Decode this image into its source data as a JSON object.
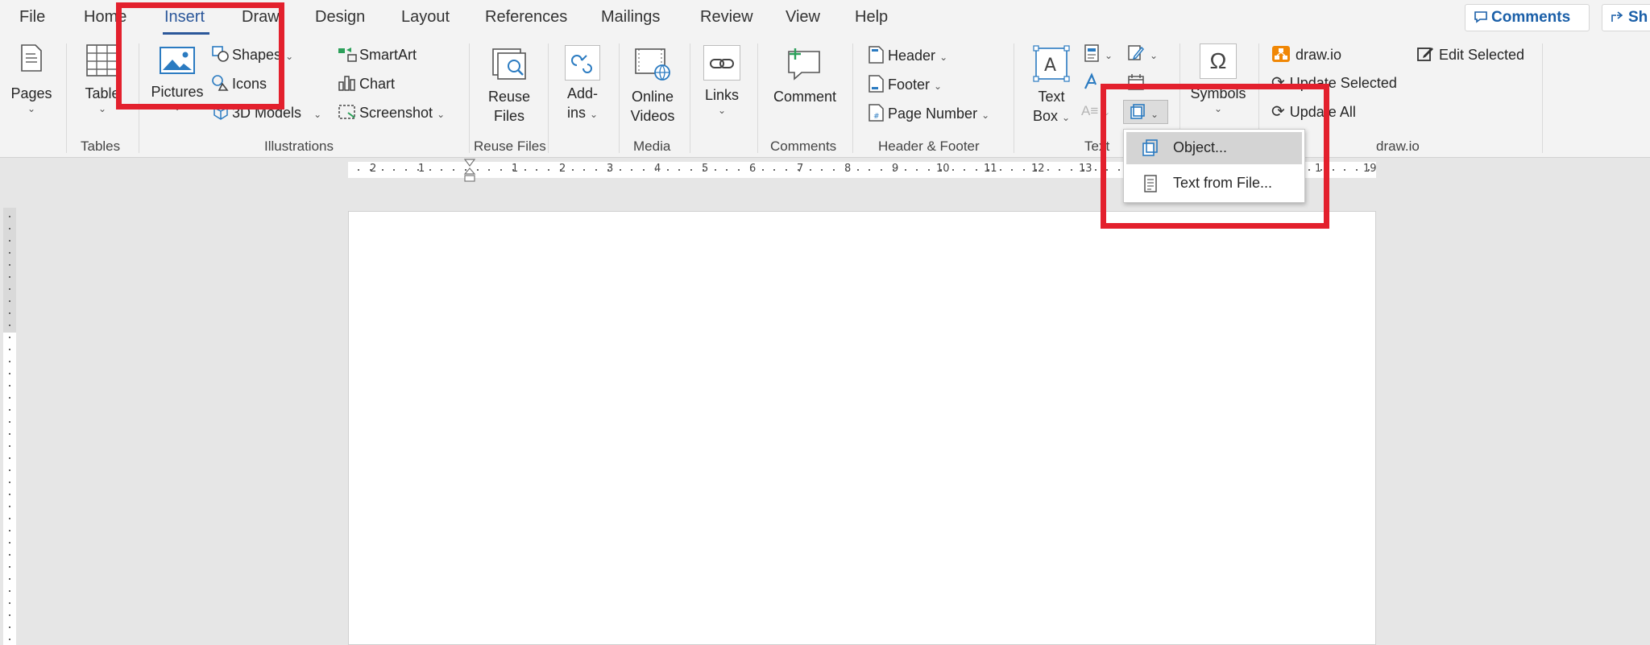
{
  "tabs": [
    "File",
    "Home",
    "Insert",
    "Draw",
    "Design",
    "Layout",
    "References",
    "Mailings",
    "Review",
    "View",
    "Help"
  ],
  "active_tab": "Insert",
  "top_right": {
    "comments": "Comments",
    "share": "Sh"
  },
  "ribbon": {
    "pages": "Pages",
    "table": "Table",
    "pictures": "Pictures",
    "shapes": "Shapes",
    "icons": "Icons",
    "models_3d": "3D Models",
    "smartart": "SmartArt",
    "chart": "Chart",
    "screenshot": "Screenshot",
    "reuse_files": [
      "Reuse",
      "Files"
    ],
    "addins": [
      "Add-",
      "ins"
    ],
    "online_videos": [
      "Online",
      "Videos"
    ],
    "links": "Links",
    "comment": "Comment",
    "header": "Header",
    "footer": "Footer",
    "page_number": "Page Number",
    "text_box": [
      "Text",
      "Box"
    ],
    "symbols": "Symbols",
    "drawio": "draw.io",
    "update_selected": "Update Selected",
    "update_all": "Update All",
    "edit_selected": "Edit Selected",
    "groups": {
      "tables": "Tables",
      "illustrations": "Illustrations",
      "reuse_files": "Reuse Files",
      "media": "Media",
      "comments": "Comments",
      "header_footer": "Header & Footer",
      "text": "Text",
      "drawio": "draw.io"
    }
  },
  "object_menu": {
    "items": [
      "Object...",
      "Text from File..."
    ]
  },
  "ruler": {
    "left_numbers": [
      "2",
      "1"
    ],
    "numbers": [
      "1",
      "2",
      "3",
      "4",
      "5",
      "6",
      "7",
      "8",
      "9",
      "10",
      "11",
      "12",
      "13"
    ],
    "right_numbers": [
      "1",
      "19"
    ]
  },
  "colors": {
    "accent": "#2b579a",
    "highlight": "#e3202d",
    "drawio_orange": "#f08705"
  }
}
